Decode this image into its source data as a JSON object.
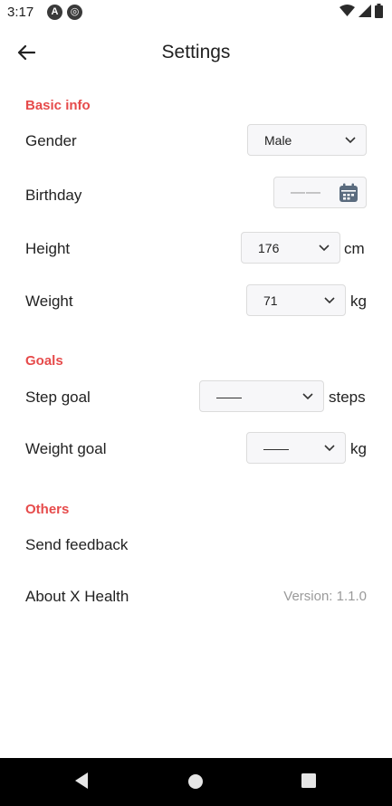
{
  "status_bar": {
    "time": "3:17",
    "icons": [
      "app-a-icon",
      "app-radar-icon",
      "wifi-icon",
      "signal-icon",
      "battery-icon"
    ]
  },
  "header": {
    "title": "Settings",
    "back_icon": "back-arrow-icon"
  },
  "sections": {
    "basic_info": {
      "title": "Basic info",
      "gender": {
        "label": "Gender",
        "value": "Male"
      },
      "birthday": {
        "label": "Birthday",
        "value": "——"
      },
      "height": {
        "label": "Height",
        "value": "176",
        "unit": "cm"
      },
      "weight": {
        "label": "Weight",
        "value": "71",
        "unit": "kg"
      }
    },
    "goals": {
      "title": "Goals",
      "step_goal": {
        "label": "Step goal",
        "value": "——",
        "unit": "steps"
      },
      "weight_goal": {
        "label": "Weight goal",
        "value": "——",
        "unit": "kg"
      }
    },
    "others": {
      "title": "Others",
      "send_feedback": {
        "label": "Send feedback"
      },
      "about": {
        "label": "About X Health",
        "version": "Version: 1.1.0"
      }
    }
  },
  "colors": {
    "accent": "#e64b4b",
    "field_bg": "#f7f7f9",
    "muted_text": "#9a9a9a"
  }
}
